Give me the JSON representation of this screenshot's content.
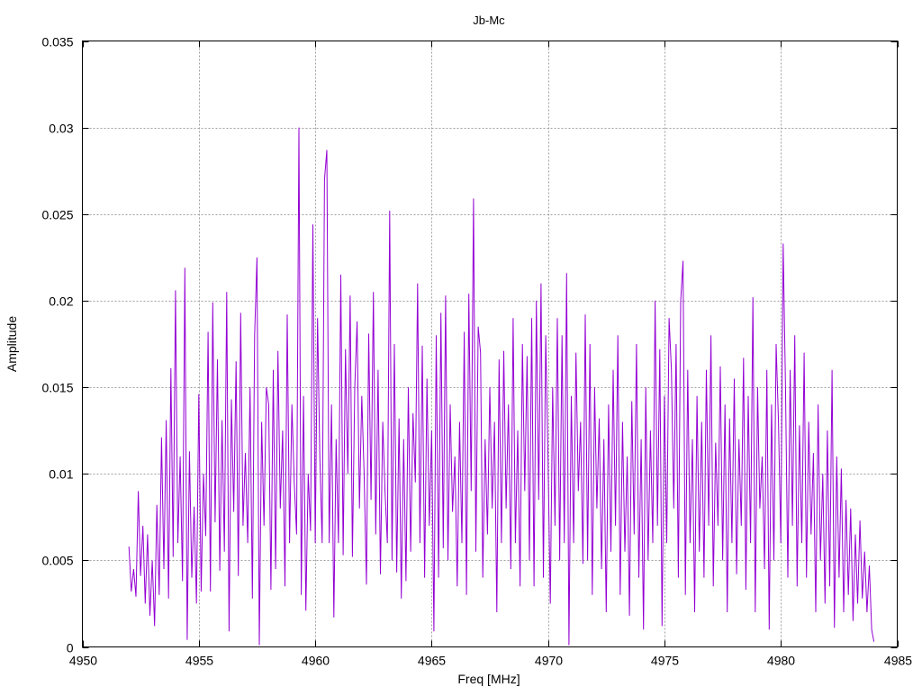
{
  "chart_data": {
    "type": "line",
    "title": "Jb-Mc",
    "xlabel": "Freq [MHz]",
    "ylabel": "Amplitude",
    "xlim": [
      4950,
      4985
    ],
    "ylim": [
      0,
      0.035
    ],
    "xticks": [
      "4950",
      "4955",
      "4960",
      "4965",
      "4970",
      "4975",
      "4980",
      "4985"
    ],
    "xtick_values": [
      4950,
      4955,
      4960,
      4965,
      4970,
      4975,
      4980,
      4985
    ],
    "yticks": [
      "0",
      "0.005",
      "0.01",
      "0.015",
      "0.02",
      "0.025",
      "0.03",
      "0.035"
    ],
    "ytick_values": [
      0,
      0.005,
      0.01,
      0.015,
      0.02,
      0.025,
      0.03,
      0.035
    ],
    "grid": true,
    "legend": "none",
    "series": [
      {
        "name": "Jb-Mc",
        "color": "#9400d3",
        "x_start": 4952.0,
        "x_step": 0.1,
        "values": [
          0.0058,
          0.0032,
          0.0045,
          0.0029,
          0.009,
          0.0041,
          0.007,
          0.0025,
          0.0065,
          0.0018,
          0.005,
          0.0012,
          0.0082,
          0.003,
          0.0121,
          0.0045,
          0.0131,
          0.0028,
          0.0161,
          0.0052,
          0.0206,
          0.006,
          0.011,
          0.0038,
          0.0219,
          0.0004,
          0.0113,
          0.004,
          0.0081,
          0.0025,
          0.0146,
          0.0032,
          0.01,
          0.0064,
          0.0182,
          0.0032,
          0.0199,
          0.0072,
          0.0166,
          0.0044,
          0.0131,
          0.0055,
          0.0205,
          0.0009,
          0.0143,
          0.0078,
          0.0165,
          0.0041,
          0.0193,
          0.007,
          0.0112,
          0.006,
          0.015,
          0.0028,
          0.018,
          0.0225,
          0.0001,
          0.013,
          0.007,
          0.015,
          0.014,
          0.0033,
          0.016,
          0.0045,
          0.0171,
          0.008,
          0.0125,
          0.0035,
          0.0192,
          0.006,
          0.014,
          0.0095,
          0.0065,
          0.03,
          0.003,
          0.0145,
          0.0021,
          0.01,
          0.0067,
          0.0244,
          0.006,
          0.019,
          0.011,
          0.006,
          0.027,
          0.0287,
          0.006,
          0.014,
          0.0017,
          0.012,
          0.006,
          0.0215,
          0.0053,
          0.0172,
          0.01,
          0.0203,
          0.0052,
          0.015,
          0.0188,
          0.008,
          0.0145,
          0.01,
          0.0036,
          0.0181,
          0.0085,
          0.0205,
          0.0065,
          0.016,
          0.0042,
          0.013,
          0.009,
          0.006,
          0.0252,
          0.005,
          0.0175,
          0.0043,
          0.0132,
          0.0028,
          0.012,
          0.0038,
          0.015,
          0.0055,
          0.0135,
          0.0095,
          0.021,
          0.006,
          0.0174,
          0.004,
          0.0155,
          0.007,
          0.0125,
          0.0009,
          0.018,
          0.004,
          0.0193,
          0.0057,
          0.0203,
          0.005,
          0.014,
          0.0078,
          0.011,
          0.0035,
          0.013,
          0.006,
          0.0182,
          0.003,
          0.0204,
          0.009,
          0.0259,
          0.0055,
          0.0185,
          0.017,
          0.004,
          0.012,
          0.0065,
          0.015,
          0.008,
          0.013,
          0.002,
          0.0166,
          0.006,
          0.0171,
          0.008,
          0.014,
          0.0045,
          0.019,
          0.006,
          0.0125,
          0.0035,
          0.0175,
          0.009,
          0.0168,
          0.005,
          0.019,
          0.0035,
          0.02,
          0.0085,
          0.021,
          0.004,
          0.018,
          0.011,
          0.0025,
          0.015,
          0.007,
          0.019,
          0.005,
          0.018,
          0.006,
          0.0216,
          0.0001,
          0.0145,
          0.006,
          0.017,
          0.009,
          0.013,
          0.0048,
          0.0192,
          0.005,
          0.0175,
          0.003,
          0.015,
          0.008,
          0.0132,
          0.0045,
          0.012,
          0.002,
          0.014,
          0.0055,
          0.016,
          0.007,
          0.018,
          0.003,
          0.013,
          0.0055,
          0.011,
          0.0018,
          0.0142,
          0.0065,
          0.0175,
          0.004,
          0.012,
          0.001,
          0.015,
          0.005,
          0.0125,
          0.006,
          0.02,
          0.007,
          0.0172,
          0.0012,
          0.0145,
          0.006,
          0.019,
          0.016,
          0.008,
          0.0175,
          0.004,
          0.02,
          0.0223,
          0.003,
          0.016,
          0.006,
          0.012,
          0.002,
          0.0145,
          0.0055,
          0.013,
          0.004,
          0.016,
          0.007,
          0.018,
          0.0035,
          0.0118,
          0.007,
          0.0162,
          0.005,
          0.014,
          0.002,
          0.0132,
          0.006,
          0.0155,
          0.0042,
          0.012,
          0.007,
          0.0167,
          0.0033,
          0.0145,
          0.006,
          0.0202,
          0.002,
          0.015,
          0.008,
          0.011,
          0.0045,
          0.016,
          0.001,
          0.014,
          0.005,
          0.0175,
          0.013,
          0.006,
          0.0233,
          0.015,
          0.004,
          0.016,
          0.007,
          0.018,
          0.0035,
          0.0128,
          0.006,
          0.017,
          0.004,
          0.013,
          0.0065,
          0.0112,
          0.002,
          0.014,
          0.005,
          0.01,
          0.0025,
          0.0125,
          0.0035,
          0.016,
          0.0011,
          0.011,
          0.004,
          0.0103,
          0.002,
          0.0085,
          0.003,
          0.008,
          0.0015,
          0.0065,
          0.0025,
          0.0073,
          0.0028,
          0.0055,
          0.002,
          0.0047,
          0.001,
          0.0003
        ]
      }
    ]
  }
}
